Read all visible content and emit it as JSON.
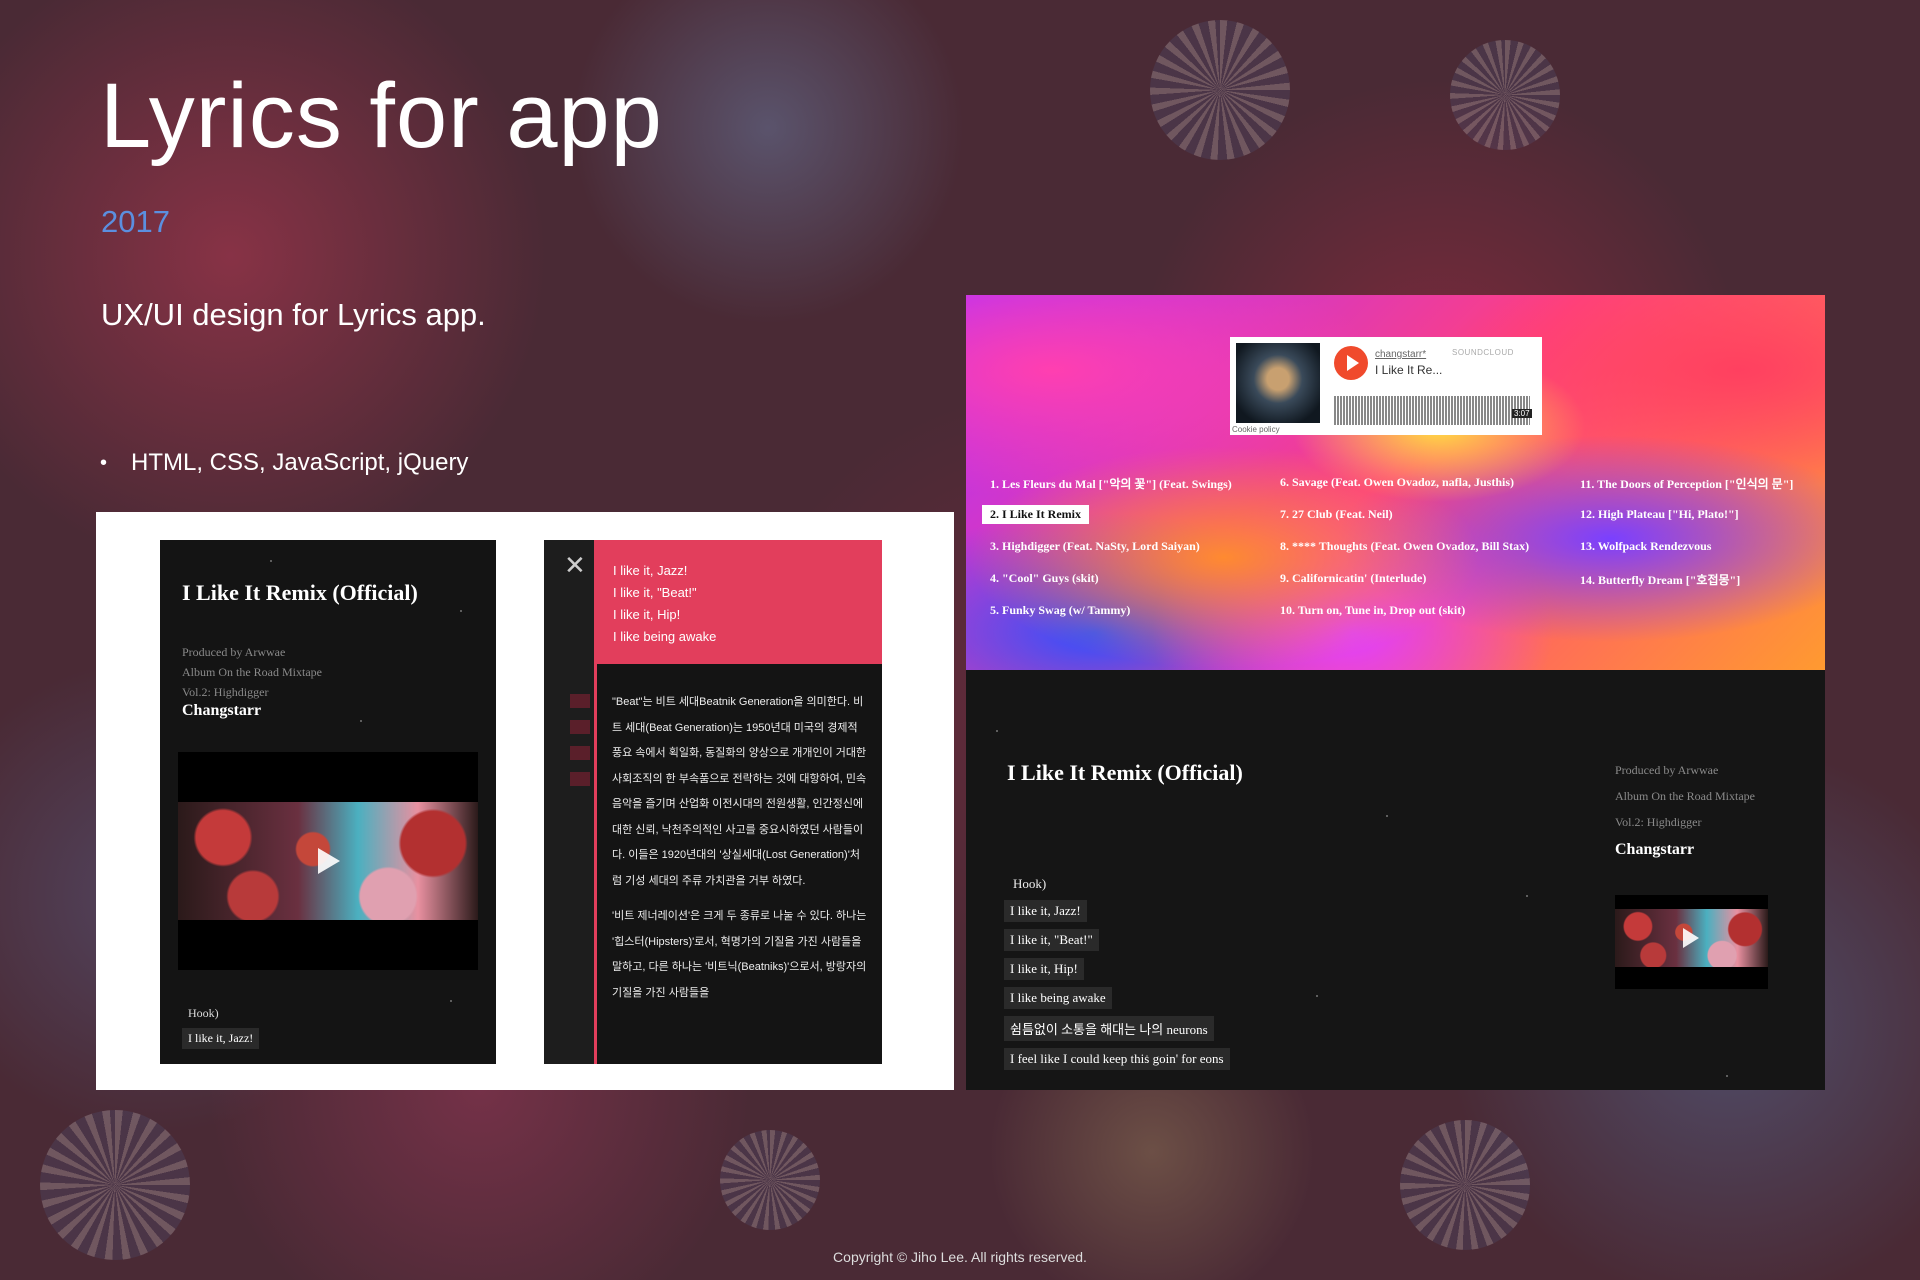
{
  "header": {
    "title": "Lyrics for app",
    "year": "2017",
    "description": "UX/UI design for Lyrics app.",
    "tech_bullet": "•",
    "tech": "HTML, CSS, JavaScript, jQuery"
  },
  "mobile_1": {
    "song_title": "I Like It Remix (Official)",
    "credits": [
      "Produced by Arwwae",
      "Album On the Road Mixtape",
      "Vol.2: Highdigger"
    ],
    "artist": "Changstarr",
    "hook_label": "Hook)",
    "first_line": "I like it, Jazz!"
  },
  "mobile_2": {
    "close_symbol": "✕",
    "highlighted_lines": [
      "I like it, Jazz!",
      "I like it, \"Beat!\"",
      "I like it, Hip!",
      "I like being awake"
    ],
    "paragraphs": [
      "\"Beat\"는 비트 세대Beatnik Generation을 의미한다. 비트 세대(Beat Generation)는 1950년대 미국의 경제적 풍요 속에서 획일화, 동질화의 양상으로 개개인이 거대한 사회조직의 한 부속품으로 전락하는 것에 대항하여, 민속음악을 즐기며 산업화 이전시대의 전원생활, 인간정신에 대한 신뢰, 낙천주의적인 사고를 중요시하였던 사람들이다. 이들은 1920년대의 '상실세대(Lost Generation)'처럼 기성 세대의 주류 가치관을 거부 하였다.",
      "'비트 제너레이션'은 크게 두 종류로 나눌 수 있다. 하나는 '힙스터(Hipsters)'로서, 혁명가의 기질을 가진 사람들을 말하고, 다른 하나는 '비트닉(Beatniks)'으로서, 방랑자의 기질을 가진 사람들을"
    ]
  },
  "desktop": {
    "soundcloud": {
      "user": "changstarr*",
      "track": "I Like It Re...",
      "brand": "SOUNDCLOUD",
      "duration": "3:07",
      "cookie": "Cookie policy"
    },
    "tracks": [
      "1. Les Fleurs du Mal [\"악의 꽃\"] (Feat. Swings)",
      "2. I Like It Remix",
      "3. Highdigger (Feat. NaSty, Lord Saiyan)",
      "4. \"Cool\" Guys (skit)",
      "5. Funky Swag (w/ Tammy)",
      "6. Savage (Feat. Owen Ovadoz, nafla, Justhis)",
      "7. 27 Club (Feat. Neil)",
      "8. **** Thoughts (Feat. Owen Ovadoz, Bill Stax)",
      "9. Californicatin' (Interlude)",
      "10. Turn on, Tune in, Drop out (skit)",
      "11. The Doors of Perception [\"인식의 문\"]",
      "12. High Plateau [\"Hi, Plato!\"]",
      "13. Wolfpack Rendezvous",
      "14. Butterfly Dream [\"호접몽\"]"
    ],
    "selected_track_index": 1,
    "song_title": "I Like It Remix (Official)",
    "credits": [
      "Produced by Arwwae",
      "Album On the Road Mixtape",
      "Vol.2: Highdigger"
    ],
    "artist": "Changstarr",
    "hook_label": "Hook)",
    "lines": [
      "I like it, Jazz!",
      "I like it, \"Beat!\"",
      "I like it, Hip!",
      "I like being awake",
      "쉼틈없이 소통을 해대는 나의 neurons",
      "I feel like I could keep this goin' for eons"
    ]
  },
  "footer": {
    "copyright": "Copyright © Jiho Lee. All rights reserved."
  },
  "colors": {
    "accent_blue": "#5b8fe0",
    "lyric_pink": "#e23e5c",
    "soundcloud_orange": "#f04a2c"
  }
}
